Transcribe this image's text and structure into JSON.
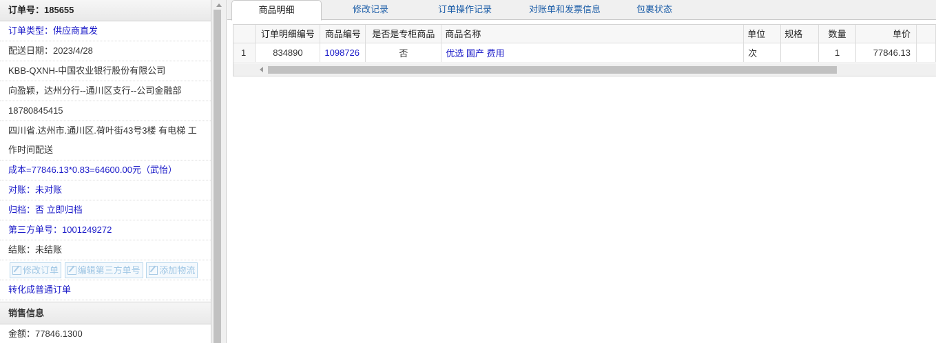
{
  "order": {
    "number_label": "订单号：185655",
    "type": "订单类型：供应商直发",
    "delivery_date": "配送日期：2023/4/28",
    "customer": "KBB-QXNH-中国农业银行股份有限公司",
    "contact": "向盈颖，达州分行--通川区支行--公司金融部",
    "phone": "18780845415",
    "address": "四川省.达州市.通川区.荷叶街43号3楼 有电梯 工作时间配送",
    "cost": "成本=77846.13*0.83=64600.00元（武怡）",
    "reconcile": "对账：未对账",
    "archive_label": "归档：",
    "archive_value": "否 立即归档",
    "third_party_no": "第三方单号：1001249272",
    "settlement": "结账：未结账",
    "buttons": {
      "edit_order": "修改订单",
      "edit_third": "编辑第三方单号",
      "add_logistics": "添加物流"
    },
    "convert": "转化成普通订单"
  },
  "sales": {
    "title": "销售信息",
    "amount": "金额：77846.1300"
  },
  "tabs": [
    {
      "label": "商品明细"
    },
    {
      "label": "修改记录"
    },
    {
      "label": "订单操作记录"
    },
    {
      "label": "对账单和发票信息"
    },
    {
      "label": "包裹状态"
    }
  ],
  "table": {
    "headers": {
      "detail_no": "订单明细编号",
      "product_no": "商品编号",
      "cabinet": "是否是专柜商品",
      "name": "商品名称",
      "unit": "单位",
      "spec": "规格",
      "qty": "数量",
      "price": "单价"
    },
    "rows": [
      {
        "index": "1",
        "detail_no": "834890",
        "product_no": "1098726",
        "cabinet": "否",
        "name": "优选 国产 费用",
        "unit": "次",
        "spec": "",
        "qty": "1",
        "price": "77846.13"
      }
    ]
  },
  "colors": {
    "link": "#1a1ac8",
    "tab_text": "#1d5ea8"
  }
}
